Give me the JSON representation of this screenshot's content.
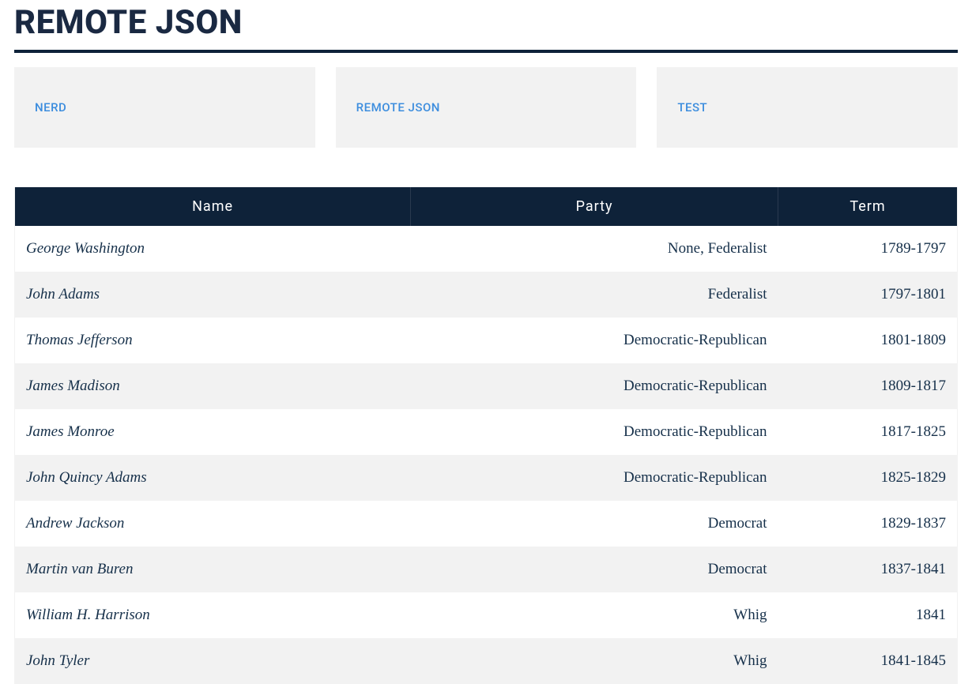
{
  "title": "Remote JSON",
  "cards": [
    {
      "label": "Nerd"
    },
    {
      "label": "Remote JSON"
    },
    {
      "label": "test"
    }
  ],
  "table": {
    "columns": [
      "Name",
      "Party",
      "Term"
    ],
    "rows": [
      {
        "name": "George Washington",
        "party": "None, Federalist",
        "term": "1789-1797"
      },
      {
        "name": "John Adams",
        "party": "Federalist",
        "term": "1797-1801"
      },
      {
        "name": "Thomas Jefferson",
        "party": "Democratic-Republican",
        "term": "1801-1809"
      },
      {
        "name": "James Madison",
        "party": "Democratic-Republican",
        "term": "1809-1817"
      },
      {
        "name": "James Monroe",
        "party": "Democratic-Republican",
        "term": "1817-1825"
      },
      {
        "name": "John Quincy Adams",
        "party": "Democratic-Republican",
        "term": "1825-1829"
      },
      {
        "name": "Andrew Jackson",
        "party": "Democrat",
        "term": "1829-1837"
      },
      {
        "name": "Martin van Buren",
        "party": "Democrat",
        "term": "1837-1841"
      },
      {
        "name": "William H. Harrison",
        "party": "Whig",
        "term": "1841"
      },
      {
        "name": "John Tyler",
        "party": "Whig",
        "term": "1841-1845"
      }
    ]
  }
}
